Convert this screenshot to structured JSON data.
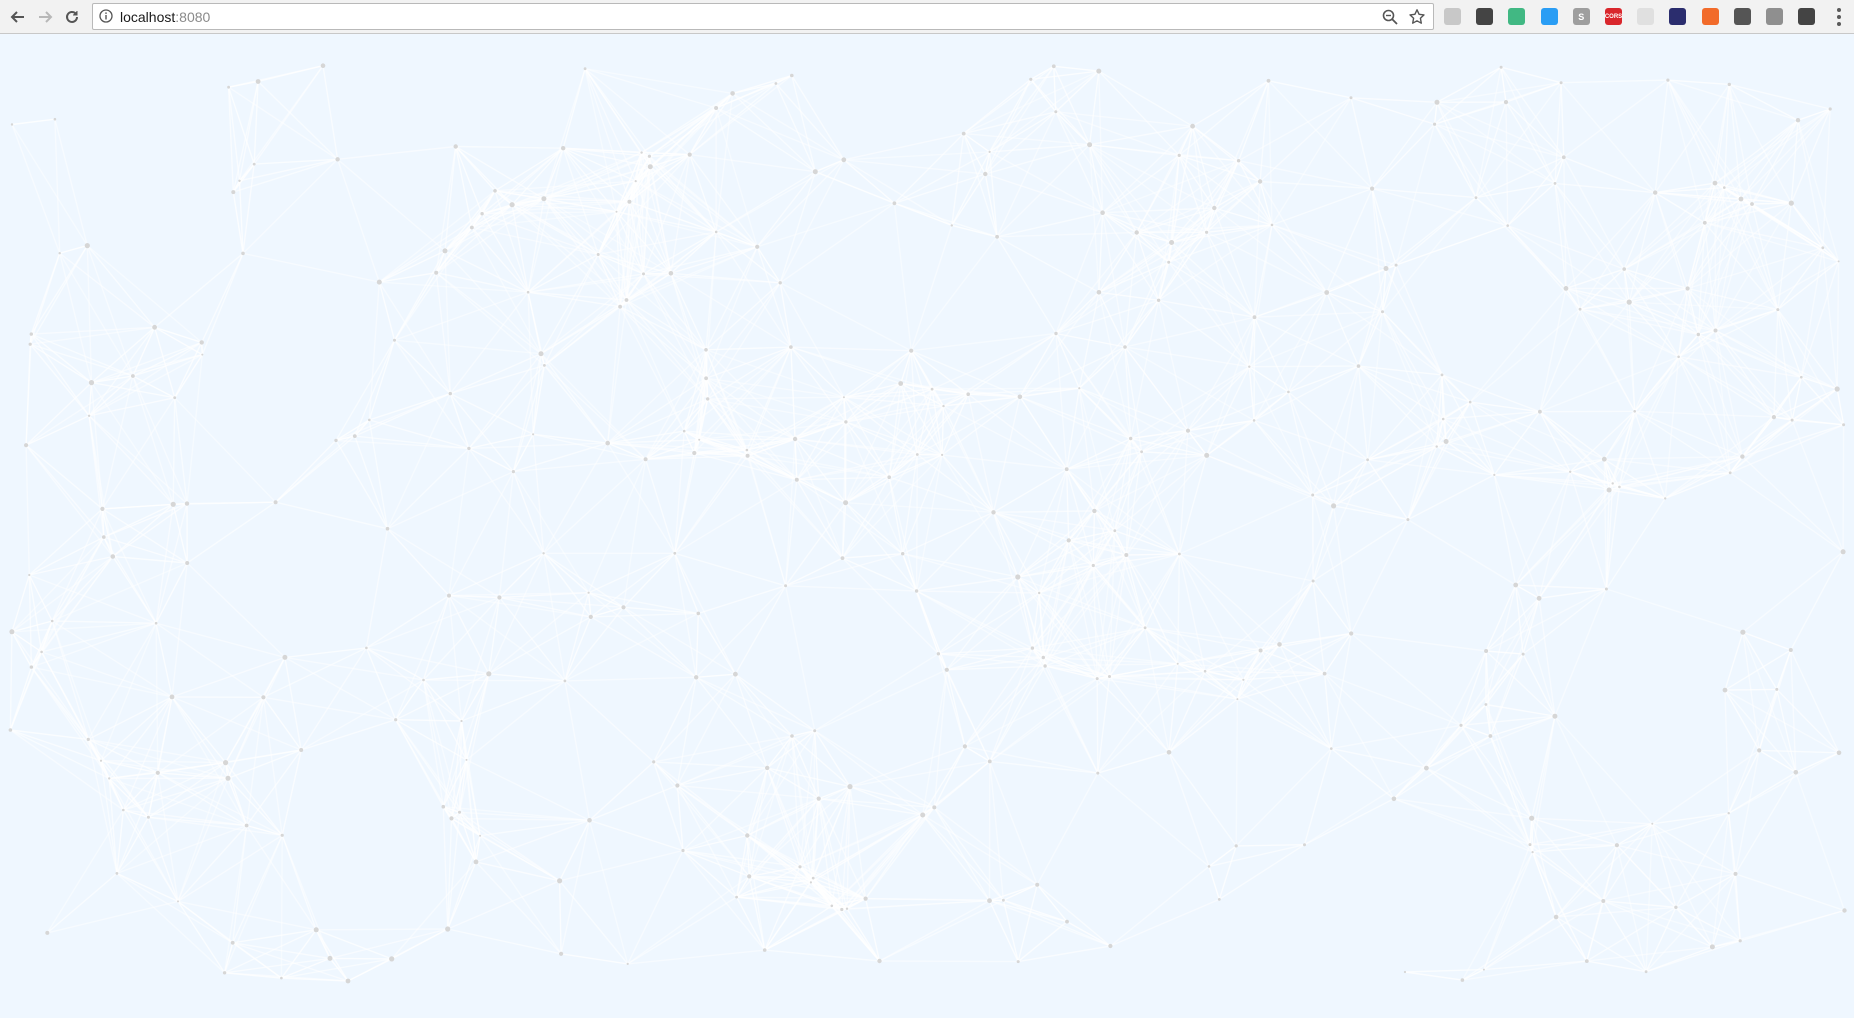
{
  "browser": {
    "url_host": "localhost",
    "url_port": ":8080",
    "icons": {
      "back": "back-arrow-icon",
      "forward": "forward-arrow-icon",
      "reload": "reload-icon",
      "site_info": "info-icon",
      "zoom": "zoom-icon",
      "bookmark": "star-icon",
      "menu": "menu-dots-icon"
    },
    "extensions": [
      {
        "name": "extension-link-icon",
        "color": "#c8c8c8",
        "glyph": ""
      },
      {
        "name": "extension-sync-icon",
        "color": "#444444",
        "glyph": ""
      },
      {
        "name": "extension-vue-icon",
        "color": "#41b883",
        "glyph": ""
      },
      {
        "name": "extension-cloud-icon",
        "color": "#2a9df4",
        "glyph": ""
      },
      {
        "name": "extension-s-icon",
        "color": "#9e9e9e",
        "glyph": "S"
      },
      {
        "name": "extension-cors-icon",
        "color": "#d9262c",
        "glyph": "CORS"
      },
      {
        "name": "extension-document-icon",
        "color": "#e0e0e0",
        "glyph": ""
      },
      {
        "name": "extension-dark-icon",
        "color": "#2b2d6e",
        "glyph": ""
      },
      {
        "name": "extension-orange-icon",
        "color": "#f26b2a",
        "glyph": ""
      },
      {
        "name": "extension-qr-icon",
        "color": "#555555",
        "glyph": ""
      },
      {
        "name": "extension-circle-icon",
        "color": "#8f8f8f",
        "glyph": ""
      },
      {
        "name": "extension-signal-icon",
        "color": "#444444",
        "glyph": ""
      }
    ]
  },
  "page": {
    "background_color": "#eff7ff",
    "line_color": "#ffffff",
    "node_color": "#d6d6d6",
    "visual": "particle network background"
  }
}
